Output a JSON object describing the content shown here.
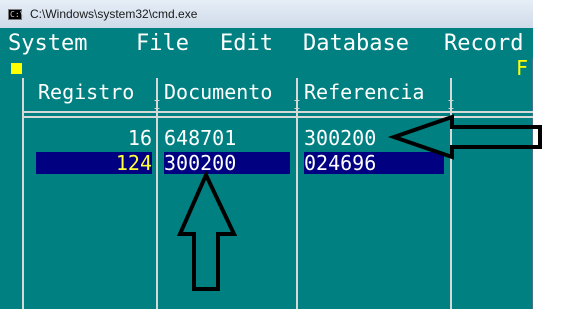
{
  "window": {
    "title": "C:\\Windows\\system32\\cmd.exe",
    "icon": "cmd-icon",
    "icon_glyph": "C:\\"
  },
  "menu": {
    "items": [
      {
        "hot": "S",
        "rest": "ystem"
      },
      {
        "hot": "F",
        "rest": "ile"
      },
      {
        "hot": "E",
        "rest": "dit"
      },
      {
        "hot": "D",
        "rest": "atabase"
      },
      {
        "hot": "R",
        "rest": "ecord"
      }
    ]
  },
  "status": {
    "right_key": "F"
  },
  "table": {
    "columns": [
      "Registro",
      "Documento",
      "Referencia"
    ],
    "rows": [
      {
        "registro": "16",
        "documento": "648701",
        "referencia": "300200",
        "selected": false
      },
      {
        "registro": "124",
        "documento": "300200",
        "referencia": "024696",
        "selected": true
      }
    ]
  },
  "colors": {
    "background": "#008080",
    "selection": "#000080",
    "highlight_text": "#ffff3a",
    "text": "#ffffff",
    "grid_lines": "#d8d8d8"
  }
}
